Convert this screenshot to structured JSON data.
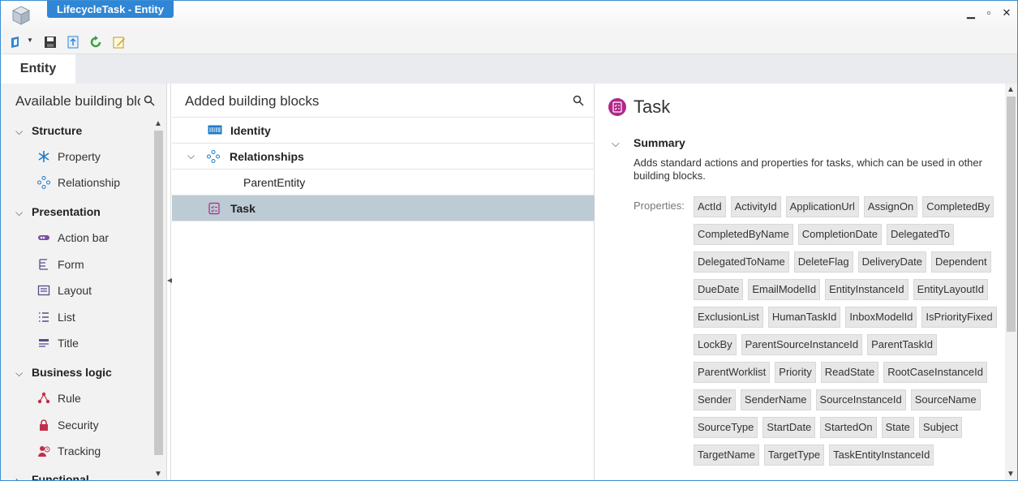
{
  "window": {
    "title": "LifecycleTask - Entity",
    "minimize": "▁",
    "restore": "▫",
    "close": "✕"
  },
  "ribbon": {
    "tab_label": "Entity"
  },
  "left_panel": {
    "title": "Available building blo",
    "groups": [
      {
        "label": "Structure",
        "items": [
          "Property",
          "Relationship"
        ]
      },
      {
        "label": "Presentation",
        "items": [
          "Action bar",
          "Form",
          "Layout",
          "List",
          "Title"
        ]
      },
      {
        "label": "Business logic",
        "items": [
          "Rule",
          "Security",
          "Tracking"
        ]
      },
      {
        "label": "Functional",
        "items": []
      }
    ]
  },
  "middle_panel": {
    "title": "Added building blocks",
    "rows": [
      {
        "label": "Identity",
        "bold": true
      },
      {
        "label": "Relationships",
        "bold": true
      },
      {
        "label": "ParentEntity",
        "bold": false
      },
      {
        "label": "Task",
        "bold": true,
        "selected": true
      }
    ]
  },
  "detail": {
    "title": "Task",
    "summary_heading": "Summary",
    "summary_text": "Adds standard actions and properties for tasks, which can be used in other building blocks.",
    "properties_label": "Properties:",
    "properties": [
      "ActId",
      "ActivityId",
      "ApplicationUrl",
      "AssignOn",
      "CompletedBy",
      "CompletedByName",
      "CompletionDate",
      "DelegatedTo",
      "DelegatedToName",
      "DeleteFlag",
      "DeliveryDate",
      "Dependent",
      "DueDate",
      "EmailModelId",
      "EntityInstanceId",
      "EntityLayoutId",
      "ExclusionList",
      "HumanTaskId",
      "InboxModelId",
      "IsPriorityFixed",
      "LockBy",
      "ParentSourceInstanceId",
      "ParentTaskId",
      "ParentWorklist",
      "Priority",
      "ReadState",
      "RootCaseInstanceId",
      "Sender",
      "SenderName",
      "SourceInstanceId",
      "SourceName",
      "SourceType",
      "StartDate",
      "StartedOn",
      "State",
      "Subject",
      "TargetName",
      "TargetType",
      "TaskEntityInstanceId"
    ]
  },
  "colors": {
    "title_tab": "#2f86d4",
    "selected_row": "#bccbd4",
    "icon_blue": "#1e7ac8",
    "icon_purple": "#7b4fa0",
    "icon_red": "#c0304a",
    "task_icon": "#b0288a"
  }
}
